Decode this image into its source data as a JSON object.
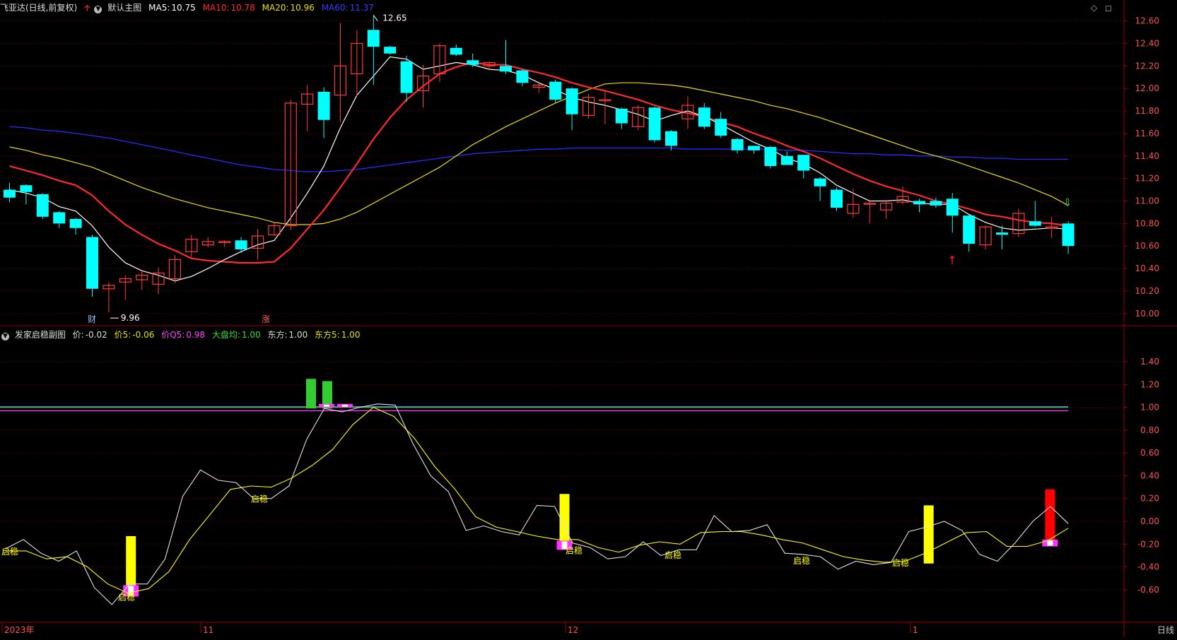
{
  "main_header": {
    "stock": "飞亚达(日线,前复权)",
    "chart_name": "默认主图",
    "ma5_label": "MA5:",
    "ma5_value": "10.75",
    "ma10_label": "MA10:",
    "ma10_value": "10.78",
    "ma20_label": "MA20:",
    "ma20_value": "10.96",
    "ma60_label": "MA60:",
    "ma60_value": "11.37"
  },
  "sub_header": {
    "indicator": "发家启稳副图",
    "jia_label": "价:",
    "jia_value": "-0.02",
    "jia5_label": "价5:",
    "jia5_value": "-0.06",
    "jiaq5_label": "价Q5:",
    "jiaq5_value": "0.98",
    "dapan_label": "大盘均:",
    "dapan_value": "1.00",
    "dongfang_label": "东方:",
    "dongfang_value": "1.00",
    "dongfang5_label": "东方5:",
    "dongfang5_value": "1.00"
  },
  "colors": {
    "bg": "#000000",
    "up": "#ff3a3a",
    "down": "#00ffff",
    "ma5": "#ffffff",
    "ma10": "#ff2a2a",
    "ma20": "#e8e000",
    "ma60": "#2a2aff",
    "grid": "#7a0000",
    "axis_text": "#ff5050",
    "sig_yellow": "#ffff00",
    "sig_magenta": "#ff33ff",
    "sig_green": "#33cc33",
    "sig_red": "#ff0000",
    "sig_pink": "#ff44aa"
  },
  "price_axis": {
    "labels": [
      "12.60",
      "12.40",
      "12.20",
      "12.00",
      "11.80",
      "11.60",
      "11.40",
      "11.20",
      "11.00",
      "10.80",
      "10.60",
      "10.40",
      "10.20",
      "10.00"
    ],
    "min": 9.93,
    "max": 12.66
  },
  "sub_axis": {
    "labels": [
      "1.40",
      "1.20",
      "1.00",
      "0.80",
      "0.60",
      "0.40",
      "0.20",
      "0.00",
      "-0.20",
      "-0.40",
      "-0.60"
    ],
    "min": -0.88,
    "max": 1.58
  },
  "annotations": {
    "high": "12.65",
    "low": "9.96",
    "cai_marker": "财",
    "zhang_marker": "涨",
    "qiwen": "启稳"
  },
  "date_axis": {
    "labels": [
      "2023年",
      "11",
      "12",
      "1"
    ]
  },
  "timeframe": "日线",
  "icons": {
    "up_arrow": "red-up-arrow-icon",
    "dropdown": "chevron-down-icon",
    "diamond": "diamond-icon",
    "expand": "expand-icon"
  },
  "chart_data": {
    "type": "candlestick",
    "candles": [
      {
        "o": 11.1,
        "c": 11.03,
        "h": 11.16,
        "l": 10.99
      },
      {
        "o": 11.14,
        "c": 11.08,
        "h": 11.15,
        "l": 10.97
      },
      {
        "o": 11.06,
        "c": 10.86,
        "h": 11.07,
        "l": 10.84
      },
      {
        "o": 10.9,
        "c": 10.8,
        "h": 10.91,
        "l": 10.76
      },
      {
        "o": 10.84,
        "c": 10.76,
        "h": 10.85,
        "l": 10.7
      },
      {
        "o": 10.68,
        "c": 10.22,
        "h": 10.7,
        "l": 10.15
      },
      {
        "o": 10.22,
        "c": 10.25,
        "h": 10.28,
        "l": 10.01
      },
      {
        "o": 10.28,
        "c": 10.31,
        "h": 10.34,
        "l": 10.12
      },
      {
        "o": 10.3,
        "c": 10.34,
        "h": 10.39,
        "l": 10.21
      },
      {
        "o": 10.26,
        "c": 10.36,
        "h": 10.41,
        "l": 10.17
      },
      {
        "o": 10.31,
        "c": 10.48,
        "h": 10.52,
        "l": 10.27
      },
      {
        "o": 10.55,
        "c": 10.66,
        "h": 10.7,
        "l": 10.5
      },
      {
        "o": 10.61,
        "c": 10.64,
        "h": 10.68,
        "l": 10.59
      },
      {
        "o": 10.63,
        "c": 10.64,
        "h": 10.65,
        "l": 10.59
      },
      {
        "o": 10.65,
        "c": 10.57,
        "h": 10.68,
        "l": 10.54
      },
      {
        "o": 10.58,
        "c": 10.69,
        "h": 10.75,
        "l": 10.48
      },
      {
        "o": 10.7,
        "c": 10.78,
        "h": 10.81,
        "l": 10.69
      },
      {
        "o": 10.78,
        "c": 11.87,
        "h": 11.9,
        "l": 10.74
      },
      {
        "o": 11.86,
        "c": 11.95,
        "h": 12.03,
        "l": 11.62
      },
      {
        "o": 11.97,
        "c": 11.72,
        "h": 12.01,
        "l": 11.56
      },
      {
        "o": 11.94,
        "c": 12.2,
        "h": 12.58,
        "l": 11.7
      },
      {
        "o": 12.13,
        "c": 12.4,
        "h": 12.52,
        "l": 11.93
      },
      {
        "o": 12.52,
        "c": 12.37,
        "h": 12.65,
        "l": 12.03
      },
      {
        "o": 12.37,
        "c": 12.31,
        "h": 12.38,
        "l": 12.3
      },
      {
        "o": 12.24,
        "c": 11.96,
        "h": 12.29,
        "l": 11.88
      },
      {
        "o": 11.98,
        "c": 12.11,
        "h": 12.21,
        "l": 11.83
      },
      {
        "o": 12.13,
        "c": 12.38,
        "h": 12.4,
        "l": 12.06
      },
      {
        "o": 12.36,
        "c": 12.3,
        "h": 12.39,
        "l": 12.29
      },
      {
        "o": 12.25,
        "c": 12.21,
        "h": 12.31,
        "l": 12.19
      },
      {
        "o": 12.2,
        "c": 12.23,
        "h": 12.24,
        "l": 12.16
      },
      {
        "o": 12.2,
        "c": 12.15,
        "h": 12.43,
        "l": 12.13
      },
      {
        "o": 12.16,
        "c": 12.05,
        "h": 12.17,
        "l": 12.02
      },
      {
        "o": 12.01,
        "c": 12.03,
        "h": 12.05,
        "l": 11.96
      },
      {
        "o": 12.06,
        "c": 11.9,
        "h": 12.08,
        "l": 11.87
      },
      {
        "o": 12.0,
        "c": 11.77,
        "h": 12.01,
        "l": 11.63
      },
      {
        "o": 11.76,
        "c": 11.92,
        "h": 11.95,
        "l": 11.73
      },
      {
        "o": 11.9,
        "c": 11.9,
        "h": 11.98,
        "l": 11.68
      },
      {
        "o": 11.82,
        "c": 11.69,
        "h": 11.83,
        "l": 11.64
      },
      {
        "o": 11.66,
        "c": 11.83,
        "h": 11.85,
        "l": 11.63
      },
      {
        "o": 11.83,
        "c": 11.54,
        "h": 11.84,
        "l": 11.52
      },
      {
        "o": 11.62,
        "c": 11.49,
        "h": 11.63,
        "l": 11.45
      },
      {
        "o": 11.73,
        "c": 11.85,
        "h": 11.93,
        "l": 11.64
      },
      {
        "o": 11.83,
        "c": 11.66,
        "h": 11.87,
        "l": 11.64
      },
      {
        "o": 11.73,
        "c": 11.58,
        "h": 11.79,
        "l": 11.56
      },
      {
        "o": 11.55,
        "c": 11.45,
        "h": 11.56,
        "l": 11.42
      },
      {
        "o": 11.49,
        "c": 11.45,
        "h": 11.49,
        "l": 11.42
      },
      {
        "o": 11.48,
        "c": 11.31,
        "h": 11.49,
        "l": 11.29
      },
      {
        "o": 11.4,
        "c": 11.32,
        "h": 11.44,
        "l": 11.32
      },
      {
        "o": 11.41,
        "c": 11.27,
        "h": 11.41,
        "l": 11.2
      },
      {
        "o": 11.2,
        "c": 11.13,
        "h": 11.21,
        "l": 11.0
      },
      {
        "o": 11.1,
        "c": 10.94,
        "h": 11.12,
        "l": 10.91
      },
      {
        "o": 10.89,
        "c": 10.97,
        "h": 11.11,
        "l": 10.85
      },
      {
        "o": 10.97,
        "c": 10.98,
        "h": 11.0,
        "l": 10.8
      },
      {
        "o": 10.92,
        "c": 10.98,
        "h": 11.0,
        "l": 10.84
      },
      {
        "o": 10.99,
        "c": 11.04,
        "h": 11.13,
        "l": 10.97
      },
      {
        "o": 11.0,
        "c": 10.97,
        "h": 11.02,
        "l": 10.9
      },
      {
        "o": 11.0,
        "c": 10.96,
        "h": 11.03,
        "l": 10.94
      },
      {
        "o": 11.02,
        "c": 10.87,
        "h": 11.07,
        "l": 10.72
      },
      {
        "o": 10.87,
        "c": 10.62,
        "h": 10.88,
        "l": 10.55
      },
      {
        "o": 10.61,
        "c": 10.77,
        "h": 10.78,
        "l": 10.57
      },
      {
        "o": 10.72,
        "c": 10.7,
        "h": 10.78,
        "l": 10.57
      },
      {
        "o": 10.71,
        "c": 10.89,
        "h": 10.93,
        "l": 10.68
      },
      {
        "o": 10.82,
        "c": 10.78,
        "h": 11.0,
        "l": 10.77
      },
      {
        "o": 10.77,
        "c": 10.77,
        "h": 10.86,
        "l": 10.67
      },
      {
        "o": 10.8,
        "c": 10.6,
        "h": 10.82,
        "l": 10.53
      }
    ],
    "ma5": [
      11.1,
      11.07,
      11.03,
      10.95,
      10.91,
      10.78,
      10.59,
      10.45,
      10.38,
      10.34,
      10.29,
      10.33,
      10.4,
      10.48,
      10.55,
      10.61,
      10.65,
      10.85,
      11.07,
      11.31,
      11.65,
      11.94,
      12.11,
      12.28,
      12.26,
      12.17,
      12.2,
      12.23,
      12.21,
      12.17,
      12.16,
      12.12,
      12.05,
      11.99,
      11.92,
      11.88,
      11.85,
      11.81,
      11.77,
      11.71,
      11.76,
      11.8,
      11.75,
      11.68,
      11.6,
      11.52,
      11.46,
      11.38,
      11.33,
      11.25,
      11.14,
      11.07,
      11.0,
      11.0,
      11.01,
      10.98,
      10.97,
      10.97,
      10.88,
      10.81,
      10.76,
      10.74,
      10.75,
      10.76,
      10.75
    ],
    "ma10": [
      11.31,
      11.27,
      11.23,
      11.18,
      11.14,
      11.05,
      10.91,
      10.79,
      10.7,
      10.62,
      10.56,
      10.49,
      10.47,
      10.46,
      10.45,
      10.45,
      10.46,
      10.58,
      10.75,
      10.92,
      11.12,
      11.33,
      11.55,
      11.74,
      11.9,
      12.02,
      12.13,
      12.19,
      12.23,
      12.21,
      12.21,
      12.17,
      12.14,
      12.1,
      12.05,
      12.01,
      11.98,
      11.94,
      11.9,
      11.85,
      11.81,
      11.78,
      11.75,
      11.7,
      11.66,
      11.6,
      11.55,
      11.49,
      11.44,
      11.38,
      11.31,
      11.24,
      11.18,
      11.13,
      11.09,
      11.05,
      11.0,
      10.97,
      10.93,
      10.88,
      10.86,
      10.83,
      10.81,
      10.8,
      10.78
    ],
    "ma20": [
      11.48,
      11.45,
      11.41,
      11.38,
      11.34,
      11.3,
      11.24,
      11.18,
      11.12,
      11.07,
      11.02,
      10.98,
      10.94,
      10.91,
      10.88,
      10.85,
      10.81,
      10.79,
      10.79,
      10.8,
      10.84,
      10.9,
      10.98,
      11.06,
      11.14,
      11.22,
      11.3,
      11.4,
      11.5,
      11.58,
      11.66,
      11.73,
      11.8,
      11.87,
      11.93,
      11.99,
      12.04,
      12.05,
      12.05,
      12.04,
      12.03,
      12.01,
      11.98,
      11.95,
      11.92,
      11.89,
      11.85,
      11.82,
      11.78,
      11.74,
      11.69,
      11.64,
      11.59,
      11.54,
      11.49,
      11.44,
      11.4,
      11.36,
      11.31,
      11.26,
      11.21,
      11.16,
      11.1,
      11.04,
      10.96
    ],
    "ma60": [
      11.66,
      11.65,
      11.63,
      11.62,
      11.6,
      11.58,
      11.56,
      11.53,
      11.5,
      11.47,
      11.44,
      11.41,
      11.38,
      11.35,
      11.32,
      11.3,
      11.28,
      11.27,
      11.26,
      11.26,
      11.27,
      11.28,
      11.3,
      11.32,
      11.34,
      11.36,
      11.38,
      11.4,
      11.42,
      11.43,
      11.44,
      11.45,
      11.46,
      11.46,
      11.47,
      11.47,
      11.47,
      11.47,
      11.47,
      11.47,
      11.47,
      11.46,
      11.46,
      11.46,
      11.46,
      11.46,
      11.46,
      11.45,
      11.45,
      11.44,
      11.43,
      11.42,
      11.42,
      11.41,
      11.41,
      11.4,
      11.4,
      11.39,
      11.39,
      11.38,
      11.38,
      11.37,
      11.37,
      11.37,
      11.37
    ],
    "sub_jia": [
      -0.24,
      -0.16,
      -0.28,
      -0.35,
      -0.26,
      -0.58,
      -0.73,
      -0.55,
      -0.55,
      -0.33,
      0.22,
      0.45,
      0.36,
      0.34,
      0.2,
      0.2,
      0.31,
      0.72,
      0.99,
      0.96,
      1.0,
      1.03,
      1.02,
      0.68,
      0.4,
      0.26,
      -0.08,
      -0.04,
      -0.09,
      -0.12,
      0.14,
      0.13,
      -0.19,
      -0.23,
      -0.33,
      -0.31,
      -0.18,
      -0.3,
      -0.25,
      -0.25,
      0.05,
      -0.09,
      -0.08,
      -0.03,
      -0.28,
      -0.29,
      -0.31,
      -0.42,
      -0.35,
      -0.38,
      -0.36,
      -0.09,
      -0.05,
      0.0,
      -0.08,
      -0.29,
      -0.35,
      -0.19,
      0.0,
      0.13,
      -0.02
    ],
    "sub_jia5": [
      -0.26,
      -0.26,
      -0.33,
      -0.31,
      -0.4,
      -0.55,
      -0.63,
      -0.59,
      -0.44,
      -0.16,
      0.06,
      0.28,
      0.31,
      0.3,
      0.38,
      0.49,
      0.63,
      0.85,
      1.0,
      0.92,
      0.73,
      0.48,
      0.28,
      0.04,
      -0.05,
      -0.09,
      -0.13,
      -0.16,
      -0.16,
      -0.23,
      -0.27,
      -0.21,
      -0.18,
      -0.2,
      -0.1,
      -0.09,
      -0.09,
      -0.12,
      -0.16,
      -0.19,
      -0.25,
      -0.31,
      -0.34,
      -0.36,
      -0.35,
      -0.28,
      -0.19,
      -0.1,
      -0.09,
      -0.22,
      -0.22,
      -0.17,
      -0.06
    ],
    "signal_bars": [
      {
        "x": 7,
        "color": "yellow",
        "from": -0.66,
        "to": -0.13
      },
      {
        "x": 32,
        "color": "yellow",
        "from": -0.25,
        "to": 0.24
      },
      {
        "x": 53,
        "color": "yellow",
        "from": -0.37,
        "to": 0.14
      },
      {
        "x": 60,
        "color": "red",
        "from": -0.21,
        "to": 0.28
      },
      {
        "x": 17,
        "color": "green",
        "from": 0.99,
        "to": 1.25
      },
      {
        "x": 18,
        "color": "green",
        "from": 0.99,
        "to": 1.23
      }
    ],
    "magenta_blocks": [
      {
        "x": 7,
        "from": -0.66,
        "to": -0.56
      },
      {
        "x": 32,
        "from": -0.25,
        "to": -0.17
      },
      {
        "x": 18,
        "from": 1.0,
        "to": 1.03
      },
      {
        "x": 19,
        "from": 1.0,
        "to": 1.03
      },
      {
        "x": 60,
        "from": -0.22,
        "to": -0.16
      }
    ],
    "qiwen_points": [
      0,
      7,
      14,
      32,
      38,
      46,
      53
    ],
    "flat_lines": {
      "jiaq5": 0.97,
      "dapan": 1.0,
      "dongfang": 1.0
    }
  }
}
